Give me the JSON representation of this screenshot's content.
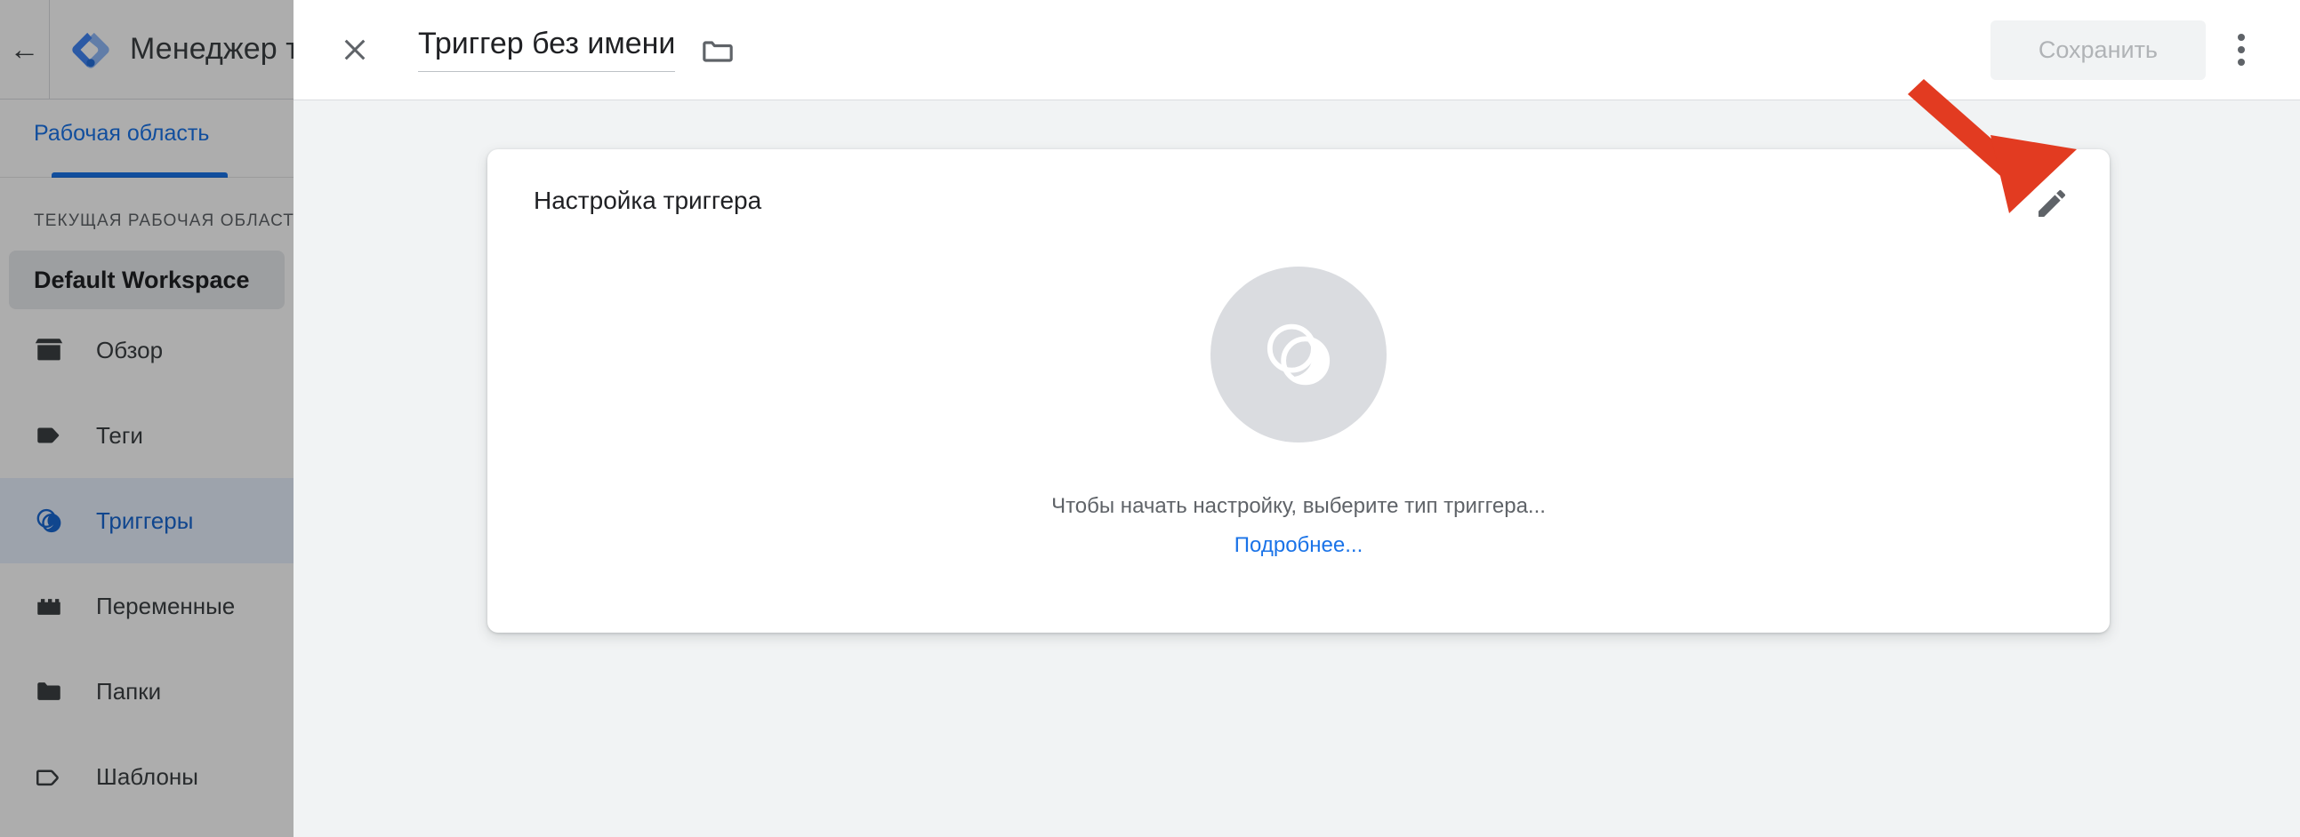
{
  "shell": {
    "back_icon": "back-arrow-icon",
    "logo_icon": "google-tag-manager-logo",
    "brand_name": "Менеджер тегов",
    "workspace_tab": "Рабочая область",
    "workspace_section_label": "ТЕКУЩАЯ РАБОЧАЯ ОБЛАСТЬ",
    "workspace_current": "Default Workspace",
    "nav_items": [
      {
        "label": "Обзор",
        "icon": "overview-icon",
        "active": false
      },
      {
        "label": "Теги",
        "icon": "tag-icon",
        "active": false
      },
      {
        "label": "Триггеры",
        "icon": "trigger-icon",
        "active": true
      },
      {
        "label": "Переменные",
        "icon": "variable-icon",
        "active": false
      },
      {
        "label": "Папки",
        "icon": "folder-icon",
        "active": false
      },
      {
        "label": "Шаблоны",
        "icon": "template-icon",
        "active": false
      }
    ]
  },
  "panel": {
    "close_icon": "close-icon",
    "title": "Триггер без имени",
    "title_placeholder": "Триггер без имени",
    "folder_icon": "folder-move-icon",
    "save_label": "Сохранить",
    "save_disabled": true,
    "more_icon": "more-vert-icon"
  },
  "card": {
    "title": "Настройка триггера",
    "edit_icon": "pencil-edit-icon",
    "empty_icon": "trigger-icon",
    "empty_text": "Чтобы начать настройку, выберите тип триггера...",
    "empty_link": "Подробнее..."
  },
  "annotation": {
    "arrow_icon": "red-arrow-annotation",
    "arrow_color": "#E23B21",
    "points_to": "pencil-edit-icon"
  },
  "colors": {
    "accent_blue": "#1a73e8",
    "active_nav_bg": "#e8f0fe",
    "active_nav_text": "#1967d2",
    "panel_bg": "#f1f3f4",
    "card_bg": "#ffffff",
    "text_primary": "#202124",
    "text_secondary": "#5f6368",
    "placeholder_circle": "#dadce0",
    "annotation_red": "#E23B21"
  }
}
